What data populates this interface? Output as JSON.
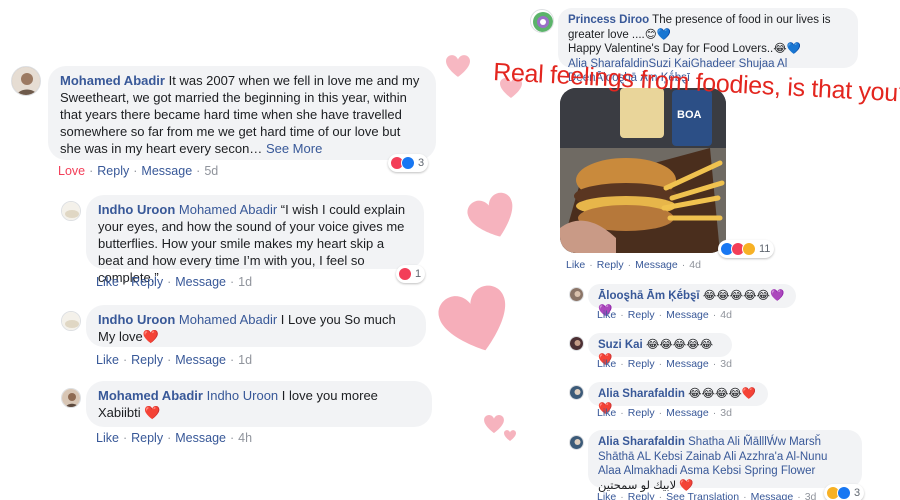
{
  "overlay": {
    "caption": "Real feelings from foodies, is that you?"
  },
  "left_thread": {
    "top_comment": {
      "author": "Mohamed Abadir",
      "text": "It was 2007 when we fell in love me and my Sweetheart, we got married the beginning in this year, within that years there became hard time when she have travelled somewhere so far from me we get hard time of our love but she was in my heart every secon…",
      "see_more": "See More",
      "reaction_count": "3",
      "actions": {
        "love": "Love",
        "reply": "Reply",
        "message": "Message",
        "time": "5d"
      }
    },
    "replies": [
      {
        "author": "Indho Uroon",
        "mention": "Mohamed Abadir",
        "text": "“I wish I could explain your eyes, and how the sound of your voice gives me butterflies. How your smile makes my heart skip a beat and how every time I’m with you, I feel so complete.”",
        "reaction_count": "1",
        "actions": {
          "like": "Like",
          "reply": "Reply",
          "message": "Message",
          "time": "1d"
        }
      },
      {
        "author": "Indho Uroon",
        "mention": "Mohamed Abadir",
        "text": "I Love you So much My love❤️",
        "actions": {
          "like": "Like",
          "reply": "Reply",
          "message": "Message",
          "time": "1d"
        }
      },
      {
        "author": "Mohamed Abadir",
        "mention": "Indho Uroon",
        "text": "I love you moree Xabiibti ❤️",
        "actions": {
          "like": "Like",
          "reply": "Reply",
          "message": "Message",
          "time": "4h"
        }
      }
    ]
  },
  "right_thread": {
    "top_comment": {
      "author": "Princess Diroo",
      "text": "The presence of food in our lives is greater love ....😊💙",
      "line2": "Happy Valentine's Day for Food Lovers..😂💙",
      "tags": "Alia SharafaldinSuzi KaiGhadeer Shujaa Al DeenĀlooȿhā Ām Ķḗbȿī",
      "reaction_count": "11",
      "actions": {
        "like": "Like",
        "reply": "Reply",
        "message": "Message",
        "time": "4d"
      }
    },
    "replies": [
      {
        "author": "Ālooȿhā Ām Ķḗbȿī",
        "text": "😂😂😂😂😂💜💜",
        "actions": {
          "like": "Like",
          "reply": "Reply",
          "message": "Message",
          "time": "4d"
        }
      },
      {
        "author": "Suzi Kai",
        "text": "😂😂😂😂😂❤️",
        "actions": {
          "like": "Like",
          "reply": "Reply",
          "message": "Message",
          "time": "3d"
        }
      },
      {
        "author": "Alia Sharafaldin",
        "text": "😂😂😂😂❤️❤️",
        "actions": {
          "like": "Like",
          "reply": "Reply",
          "message": "Message",
          "time": "3d"
        }
      },
      {
        "author": "Alia Sharafaldin",
        "mentions": "Shatha Ali M̃ālllẂw Marsȟ Shāthā AL Kebsi Zainab Ali Azzhra'a Al-Nunu Alaa Almakhadi Asma Kebsi Spring Flower",
        "text": "لابيك لو سمحتين ❤️",
        "reaction_count": "3",
        "actions": {
          "like": "Like",
          "reply": "Reply",
          "see_translation": "See Translation",
          "message": "Message",
          "time": "3d"
        }
      }
    ]
  },
  "colors": {
    "link": "#385898",
    "bubble": "#f2f3f5",
    "overlay_text": "#e3261f",
    "heart": "#f08a9a"
  }
}
